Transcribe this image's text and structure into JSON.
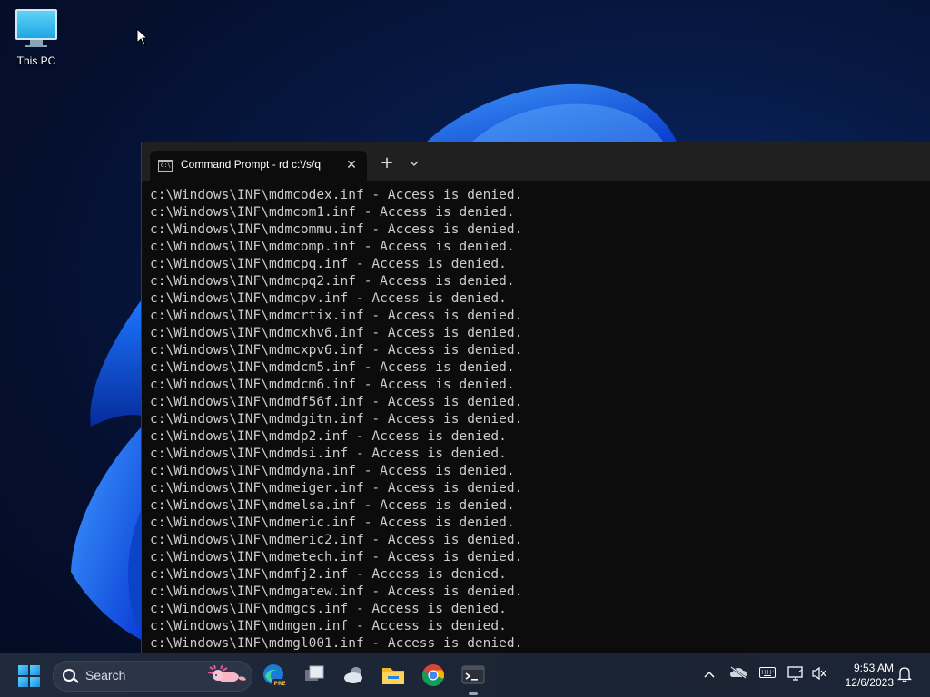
{
  "desktop": {
    "icons": [
      {
        "label": "This PC",
        "icon": "monitor-icon"
      }
    ]
  },
  "terminal": {
    "tab_title": "Command Prompt - rd  c:\\/s/q",
    "new_tab_label": "+",
    "dropdown_label": "⌄",
    "close_label": "✕",
    "lines": [
      "c:\\Windows\\INF\\mdmcodex.inf - Access is denied.",
      "c:\\Windows\\INF\\mdmcom1.inf - Access is denied.",
      "c:\\Windows\\INF\\mdmcommu.inf - Access is denied.",
      "c:\\Windows\\INF\\mdmcomp.inf - Access is denied.",
      "c:\\Windows\\INF\\mdmcpq.inf - Access is denied.",
      "c:\\Windows\\INF\\mdmcpq2.inf - Access is denied.",
      "c:\\Windows\\INF\\mdmcpv.inf - Access is denied.",
      "c:\\Windows\\INF\\mdmcrtix.inf - Access is denied.",
      "c:\\Windows\\INF\\mdmcxhv6.inf - Access is denied.",
      "c:\\Windows\\INF\\mdmcxpv6.inf - Access is denied.",
      "c:\\Windows\\INF\\mdmdcm5.inf - Access is denied.",
      "c:\\Windows\\INF\\mdmdcm6.inf - Access is denied.",
      "c:\\Windows\\INF\\mdmdf56f.inf - Access is denied.",
      "c:\\Windows\\INF\\mdmdgitn.inf - Access is denied.",
      "c:\\Windows\\INF\\mdmdp2.inf - Access is denied.",
      "c:\\Windows\\INF\\mdmdsi.inf - Access is denied.",
      "c:\\Windows\\INF\\mdmdyna.inf - Access is denied.",
      "c:\\Windows\\INF\\mdmeiger.inf - Access is denied.",
      "c:\\Windows\\INF\\mdmelsa.inf - Access is denied.",
      "c:\\Windows\\INF\\mdmeric.inf - Access is denied.",
      "c:\\Windows\\INF\\mdmeric2.inf - Access is denied.",
      "c:\\Windows\\INF\\mdmetech.inf - Access is denied.",
      "c:\\Windows\\INF\\mdmfj2.inf - Access is denied.",
      "c:\\Windows\\INF\\mdmgatew.inf - Access is denied.",
      "c:\\Windows\\INF\\mdmgcs.inf - Access is denied.",
      "c:\\Windows\\INF\\mdmgen.inf - Access is denied.",
      "c:\\Windows\\INF\\mdmgl001.inf - Access is denied."
    ]
  },
  "taskbar": {
    "search_label": "Search",
    "apps": [
      "start-icon",
      "edge-beta-icon",
      "task-view-icon",
      "weather-icon",
      "file-explorer-icon",
      "chrome-icon",
      "terminal-icon"
    ],
    "tray": [
      "chevron-up-icon",
      "onedrive-offline-icon",
      "keyboard-icon",
      "display-icon",
      "volume-muted-icon",
      "notification-bell-icon"
    ],
    "time": "9:53 AM",
    "date": "12/6/2023"
  },
  "colors": {
    "console_bg": "#0c0c0c",
    "console_fg": "#cccccc",
    "tabbar_bg": "#202020",
    "taskbar_bg": "#1c2536",
    "wallpaper_accent": "#1f6cf0"
  }
}
